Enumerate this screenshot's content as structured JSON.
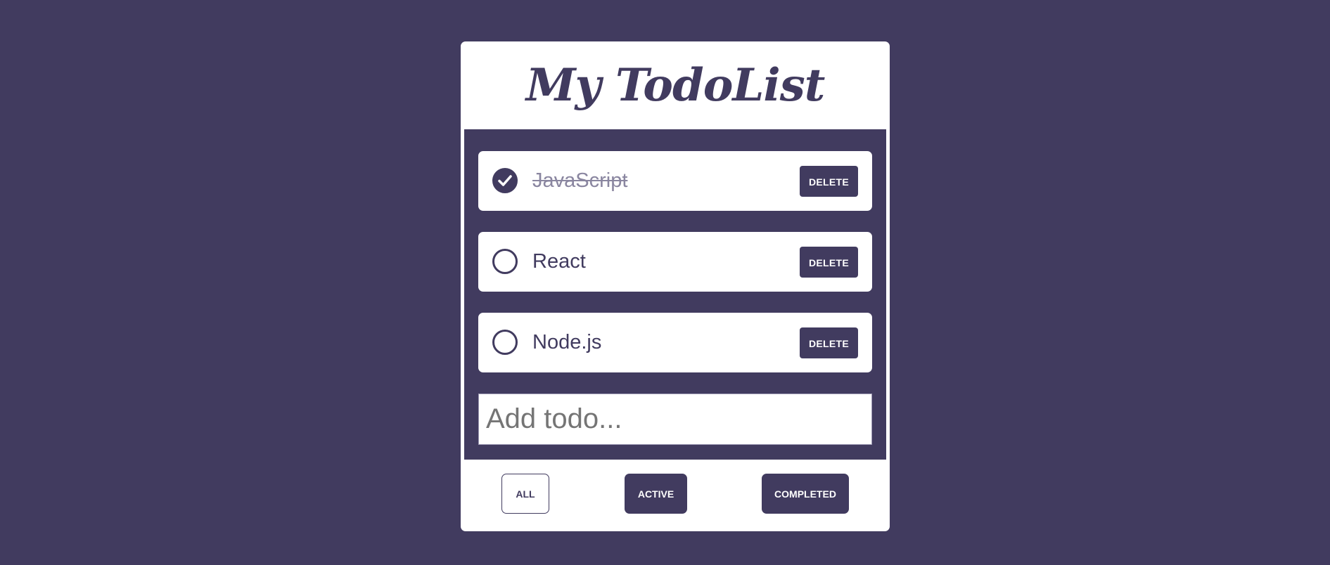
{
  "app": {
    "title": "My TodoList"
  },
  "todos": [
    {
      "text": "JavaScript",
      "completed": true,
      "delete_label": "DELETE"
    },
    {
      "text": "React",
      "completed": false,
      "delete_label": "DELETE"
    },
    {
      "text": "Node.js",
      "completed": false,
      "delete_label": "DELETE"
    }
  ],
  "add_input": {
    "placeholder": "Add todo...",
    "value": ""
  },
  "filters": {
    "all_label": "ALL",
    "active_label": "ACTIVE",
    "completed_label": "COMPLETED",
    "selected": "ALL"
  },
  "icons": {
    "checked": "check-circle-icon",
    "unchecked": "circle-icon"
  },
  "colors": {
    "accent": "#413b5f",
    "background": "#413b5f",
    "card": "#ffffff",
    "completed_text": "#8a86a0"
  }
}
